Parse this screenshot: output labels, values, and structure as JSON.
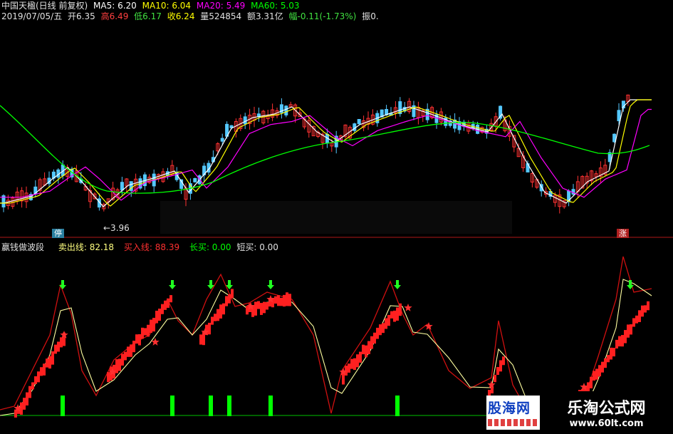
{
  "colors": {
    "bg": "#000000",
    "up": "#ff3232",
    "down": "#54c8ff",
    "ma5": "#ffffff",
    "ma10": "#ffff00",
    "ma20": "#ff00ff",
    "ma60": "#00ff00",
    "sell_line": "#ffffa0",
    "buy_line": "#ff2020",
    "signal_green": "#00ff00"
  },
  "header": {
    "row1": {
      "title": "中国天楹(日线 前复权)",
      "ma5_label": "MA5: 6.20",
      "ma10_label": "MA10: 6.04",
      "ma20_label": "MA20: 5.49",
      "ma60_label": "MA60: 5.03"
    },
    "row2": {
      "date": "2019/07/05/五",
      "open": "开6.35",
      "high": "高6.49",
      "low": "低6.17",
      "close": "收6.24",
      "volume": "量524854",
      "amount": "额3.31亿",
      "change": "幅-0.11(-1.73%)",
      "amplitude": "振0."
    }
  },
  "main_chart": {
    "low_marker": "←3.96",
    "tag_left": "停",
    "tag_right": "涨"
  },
  "indicator": {
    "name": "赢钱做波段",
    "sell_label": "卖出线: 82.18",
    "buy_label": "买入线: 88.39",
    "long_buy_label": "长买: 0.00",
    "short_buy_label": "短买: 0.00"
  },
  "watermark": {
    "left_text": "股海网",
    "right_title": "乐淘公式网",
    "right_url": "www.60lt.com"
  }
}
